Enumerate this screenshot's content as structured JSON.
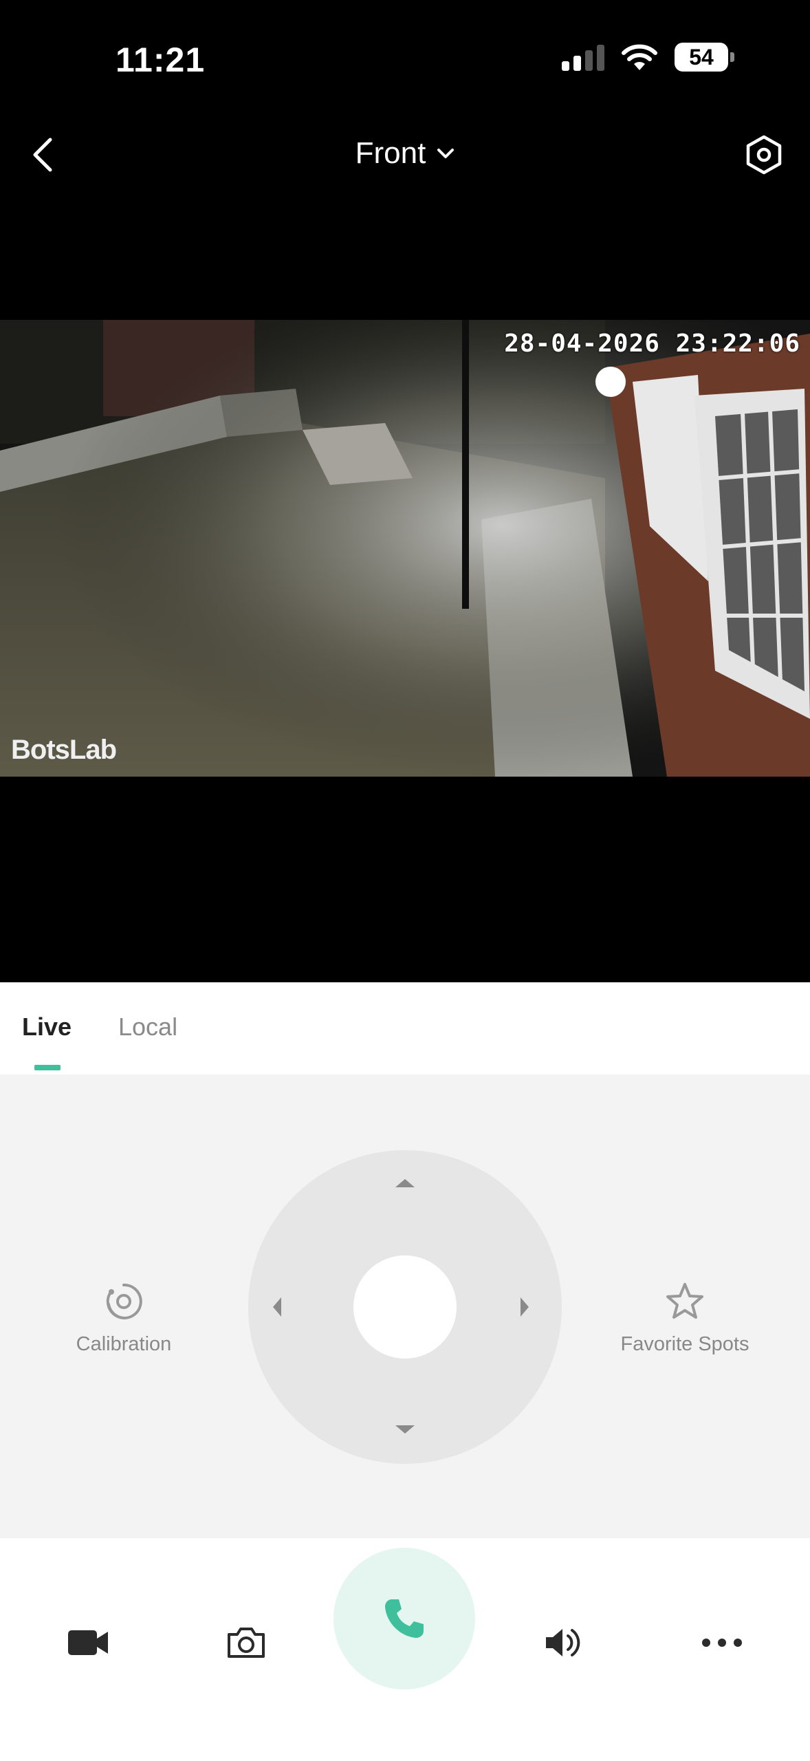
{
  "status_bar": {
    "time": "11:21",
    "battery": "54"
  },
  "nav": {
    "title": "Front"
  },
  "video": {
    "timestamp": "28-04-2026 23:22:06",
    "watermark": "BotsLab"
  },
  "tabs": [
    {
      "label": "Live",
      "active": true
    },
    {
      "label": "Local",
      "active": false
    }
  ],
  "controls": {
    "calibration_label": "Calibration",
    "favorite_label": "Favorite Spots"
  },
  "bottom_bar": {
    "items": [
      "video-record-icon",
      "camera-icon",
      "phone-icon",
      "speaker-icon",
      "more-icon"
    ]
  },
  "colors": {
    "accent": "#3fbf9c",
    "call_bg": "#e5f6f1",
    "panel_bg": "#f3f3f3"
  }
}
